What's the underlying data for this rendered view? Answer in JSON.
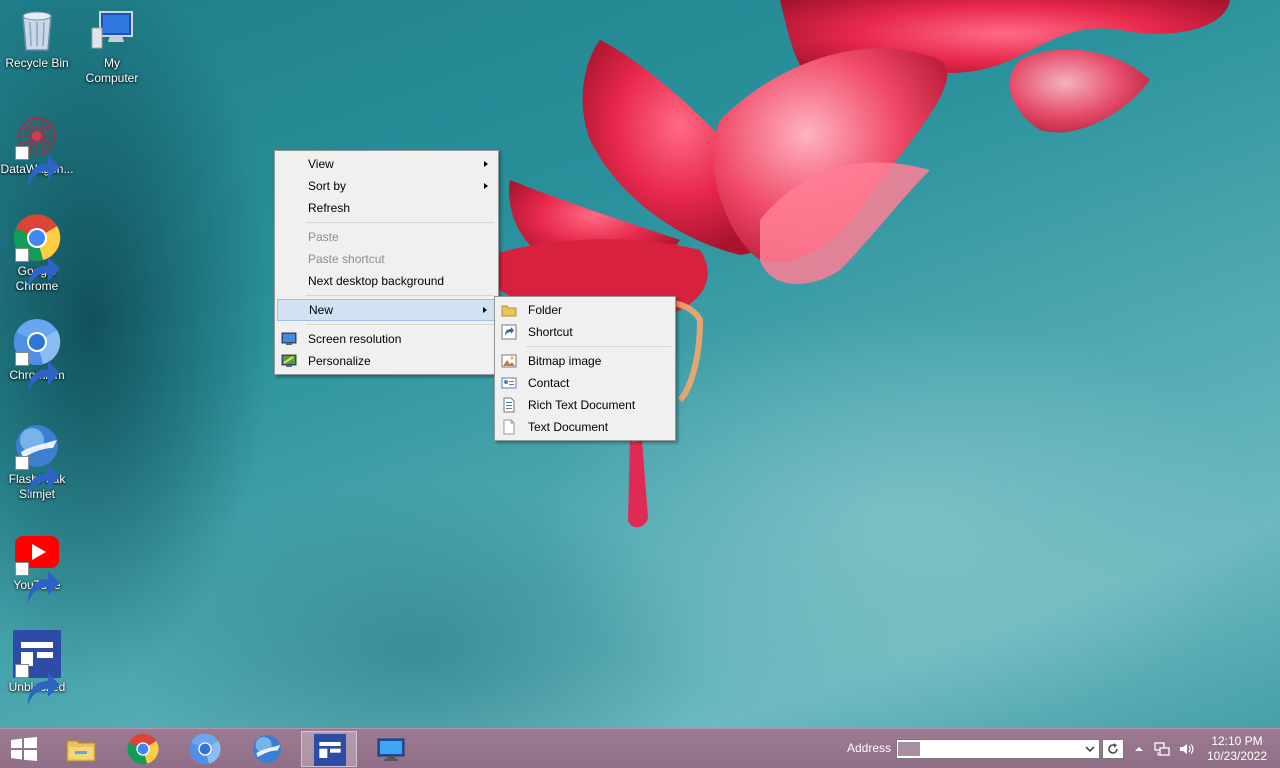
{
  "desktop": {
    "icons": [
      {
        "label": "Recycle Bin"
      },
      {
        "label": "My Computer"
      },
      {
        "label": "DataWagon..."
      },
      {
        "label": "Google Chrome"
      },
      {
        "label": "Chromium"
      },
      {
        "label": "FlashPeak Slimjet"
      },
      {
        "label": "YouTube"
      },
      {
        "label": "Unblocked"
      }
    ]
  },
  "context_menu": {
    "view": "View",
    "sort_by": "Sort by",
    "refresh": "Refresh",
    "paste": "Paste",
    "paste_shortcut": "Paste shortcut",
    "next_background": "Next desktop background",
    "new": "New",
    "screen_resolution": "Screen resolution",
    "personalize": "Personalize"
  },
  "new_submenu": {
    "folder": "Folder",
    "shortcut": "Shortcut",
    "bitmap": "Bitmap image",
    "contact": "Contact",
    "rtf": "Rich Text Document",
    "txt": "Text Document"
  },
  "taskbar": {
    "address_label": "Address",
    "address_value": "",
    "clock_time": "12:10 PM",
    "clock_date": "10/23/2022"
  }
}
